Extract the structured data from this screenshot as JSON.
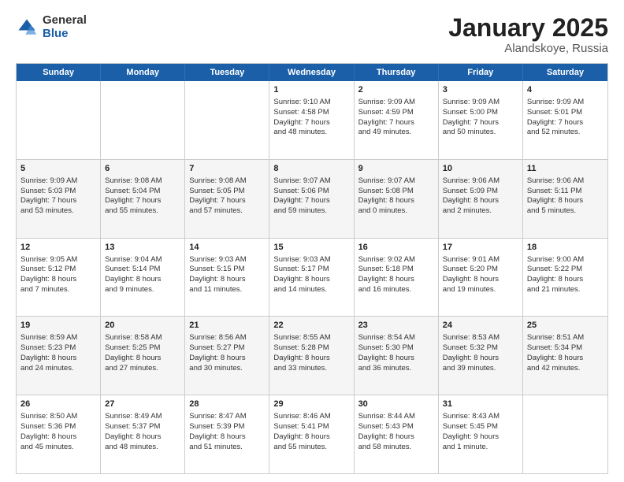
{
  "logo": {
    "general": "General",
    "blue": "Blue"
  },
  "header": {
    "month": "January 2025",
    "location": "Alandskoye, Russia"
  },
  "weekdays": [
    "Sunday",
    "Monday",
    "Tuesday",
    "Wednesday",
    "Thursday",
    "Friday",
    "Saturday"
  ],
  "rows": [
    {
      "alt": false,
      "cells": [
        {
          "day": "",
          "lines": []
        },
        {
          "day": "",
          "lines": []
        },
        {
          "day": "",
          "lines": []
        },
        {
          "day": "1",
          "lines": [
            "Sunrise: 9:10 AM",
            "Sunset: 4:58 PM",
            "Daylight: 7 hours",
            "and 48 minutes."
          ]
        },
        {
          "day": "2",
          "lines": [
            "Sunrise: 9:09 AM",
            "Sunset: 4:59 PM",
            "Daylight: 7 hours",
            "and 49 minutes."
          ]
        },
        {
          "day": "3",
          "lines": [
            "Sunrise: 9:09 AM",
            "Sunset: 5:00 PM",
            "Daylight: 7 hours",
            "and 50 minutes."
          ]
        },
        {
          "day": "4",
          "lines": [
            "Sunrise: 9:09 AM",
            "Sunset: 5:01 PM",
            "Daylight: 7 hours",
            "and 52 minutes."
          ]
        }
      ]
    },
    {
      "alt": true,
      "cells": [
        {
          "day": "5",
          "lines": [
            "Sunrise: 9:09 AM",
            "Sunset: 5:03 PM",
            "Daylight: 7 hours",
            "and 53 minutes."
          ]
        },
        {
          "day": "6",
          "lines": [
            "Sunrise: 9:08 AM",
            "Sunset: 5:04 PM",
            "Daylight: 7 hours",
            "and 55 minutes."
          ]
        },
        {
          "day": "7",
          "lines": [
            "Sunrise: 9:08 AM",
            "Sunset: 5:05 PM",
            "Daylight: 7 hours",
            "and 57 minutes."
          ]
        },
        {
          "day": "8",
          "lines": [
            "Sunrise: 9:07 AM",
            "Sunset: 5:06 PM",
            "Daylight: 7 hours",
            "and 59 minutes."
          ]
        },
        {
          "day": "9",
          "lines": [
            "Sunrise: 9:07 AM",
            "Sunset: 5:08 PM",
            "Daylight: 8 hours",
            "and 0 minutes."
          ]
        },
        {
          "day": "10",
          "lines": [
            "Sunrise: 9:06 AM",
            "Sunset: 5:09 PM",
            "Daylight: 8 hours",
            "and 2 minutes."
          ]
        },
        {
          "day": "11",
          "lines": [
            "Sunrise: 9:06 AM",
            "Sunset: 5:11 PM",
            "Daylight: 8 hours",
            "and 5 minutes."
          ]
        }
      ]
    },
    {
      "alt": false,
      "cells": [
        {
          "day": "12",
          "lines": [
            "Sunrise: 9:05 AM",
            "Sunset: 5:12 PM",
            "Daylight: 8 hours",
            "and 7 minutes."
          ]
        },
        {
          "day": "13",
          "lines": [
            "Sunrise: 9:04 AM",
            "Sunset: 5:14 PM",
            "Daylight: 8 hours",
            "and 9 minutes."
          ]
        },
        {
          "day": "14",
          "lines": [
            "Sunrise: 9:03 AM",
            "Sunset: 5:15 PM",
            "Daylight: 8 hours",
            "and 11 minutes."
          ]
        },
        {
          "day": "15",
          "lines": [
            "Sunrise: 9:03 AM",
            "Sunset: 5:17 PM",
            "Daylight: 8 hours",
            "and 14 minutes."
          ]
        },
        {
          "day": "16",
          "lines": [
            "Sunrise: 9:02 AM",
            "Sunset: 5:18 PM",
            "Daylight: 8 hours",
            "and 16 minutes."
          ]
        },
        {
          "day": "17",
          "lines": [
            "Sunrise: 9:01 AM",
            "Sunset: 5:20 PM",
            "Daylight: 8 hours",
            "and 19 minutes."
          ]
        },
        {
          "day": "18",
          "lines": [
            "Sunrise: 9:00 AM",
            "Sunset: 5:22 PM",
            "Daylight: 8 hours",
            "and 21 minutes."
          ]
        }
      ]
    },
    {
      "alt": true,
      "cells": [
        {
          "day": "19",
          "lines": [
            "Sunrise: 8:59 AM",
            "Sunset: 5:23 PM",
            "Daylight: 8 hours",
            "and 24 minutes."
          ]
        },
        {
          "day": "20",
          "lines": [
            "Sunrise: 8:58 AM",
            "Sunset: 5:25 PM",
            "Daylight: 8 hours",
            "and 27 minutes."
          ]
        },
        {
          "day": "21",
          "lines": [
            "Sunrise: 8:56 AM",
            "Sunset: 5:27 PM",
            "Daylight: 8 hours",
            "and 30 minutes."
          ]
        },
        {
          "day": "22",
          "lines": [
            "Sunrise: 8:55 AM",
            "Sunset: 5:28 PM",
            "Daylight: 8 hours",
            "and 33 minutes."
          ]
        },
        {
          "day": "23",
          "lines": [
            "Sunrise: 8:54 AM",
            "Sunset: 5:30 PM",
            "Daylight: 8 hours",
            "and 36 minutes."
          ]
        },
        {
          "day": "24",
          "lines": [
            "Sunrise: 8:53 AM",
            "Sunset: 5:32 PM",
            "Daylight: 8 hours",
            "and 39 minutes."
          ]
        },
        {
          "day": "25",
          "lines": [
            "Sunrise: 8:51 AM",
            "Sunset: 5:34 PM",
            "Daylight: 8 hours",
            "and 42 minutes."
          ]
        }
      ]
    },
    {
      "alt": false,
      "cells": [
        {
          "day": "26",
          "lines": [
            "Sunrise: 8:50 AM",
            "Sunset: 5:36 PM",
            "Daylight: 8 hours",
            "and 45 minutes."
          ]
        },
        {
          "day": "27",
          "lines": [
            "Sunrise: 8:49 AM",
            "Sunset: 5:37 PM",
            "Daylight: 8 hours",
            "and 48 minutes."
          ]
        },
        {
          "day": "28",
          "lines": [
            "Sunrise: 8:47 AM",
            "Sunset: 5:39 PM",
            "Daylight: 8 hours",
            "and 51 minutes."
          ]
        },
        {
          "day": "29",
          "lines": [
            "Sunrise: 8:46 AM",
            "Sunset: 5:41 PM",
            "Daylight: 8 hours",
            "and 55 minutes."
          ]
        },
        {
          "day": "30",
          "lines": [
            "Sunrise: 8:44 AM",
            "Sunset: 5:43 PM",
            "Daylight: 8 hours",
            "and 58 minutes."
          ]
        },
        {
          "day": "31",
          "lines": [
            "Sunrise: 8:43 AM",
            "Sunset: 5:45 PM",
            "Daylight: 9 hours",
            "and 1 minute."
          ]
        },
        {
          "day": "",
          "lines": []
        }
      ]
    }
  ]
}
